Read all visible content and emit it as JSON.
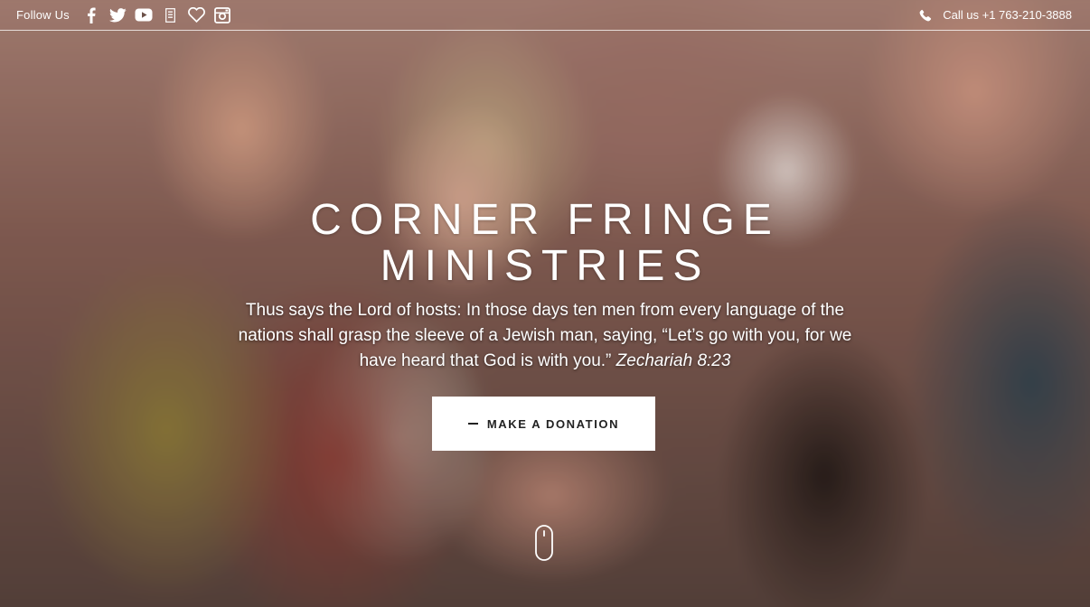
{
  "topbar": {
    "follow_label": "Follow Us",
    "social_icons": [
      "facebook-icon",
      "twitter-icon",
      "youtube-icon",
      "rss-feed-icon",
      "heart-icon",
      "instagram-icon"
    ],
    "call_label": "Call us +1 763-210-3888"
  },
  "hero": {
    "title_line1": "CORNER FRINGE",
    "title_line2": "MINISTRIES",
    "verse_text": "Thus says the Lord of hosts: In those days ten men from every language of the nations shall grasp the sleeve of a Jewish man, saying, “Let’s go with you, for we have heard that God is with you.”",
    "verse_reference": "Zechariah 8:23",
    "donate_label": "MAKE A DONATION"
  },
  "colors": {
    "text": "#ffffff",
    "button_bg": "#ffffff",
    "button_text": "#222222"
  }
}
